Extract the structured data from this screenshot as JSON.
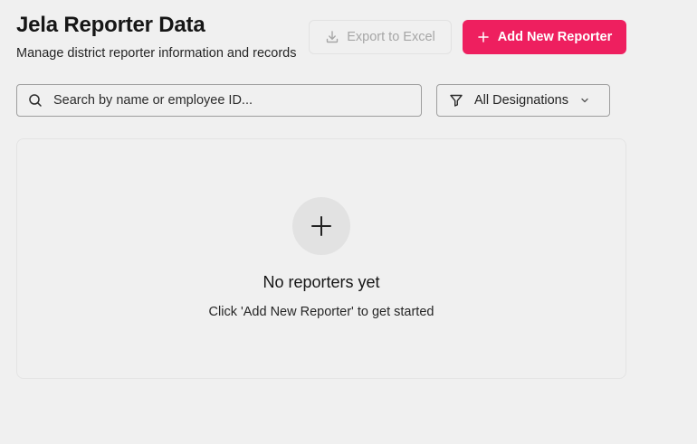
{
  "header": {
    "title": "Jela Reporter Data",
    "subtitle": "Manage district reporter information and records"
  },
  "actions": {
    "export_label": "Export to Excel",
    "export_icon": "download-icon",
    "add_label": "Add New Reporter",
    "add_icon": "plus-icon"
  },
  "search": {
    "placeholder": "Search by name or employee ID...",
    "value": "",
    "icon": "search-icon"
  },
  "filter": {
    "selected": "All Designations",
    "icon": "filter-icon"
  },
  "empty_state": {
    "icon": "plus-icon",
    "title": "No reporters yet",
    "message": "Click 'Add New Reporter' to get started"
  },
  "colors": {
    "accent": "#ee1f5f",
    "background": "#f0f0f0",
    "disabled_text": "#a6a6a6"
  }
}
